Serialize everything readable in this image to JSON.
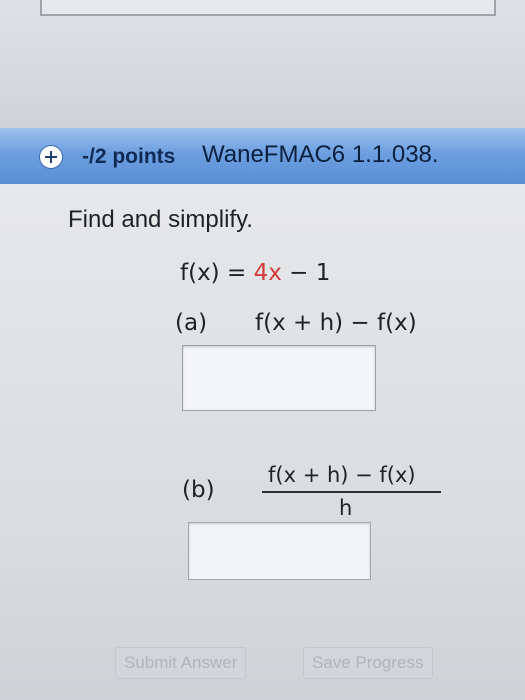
{
  "header": {
    "points_label": "-/2 points",
    "assignment_id": "WaneFMAC6 1.1.038."
  },
  "question": {
    "prompt": "Find and simplify.",
    "function": {
      "lhs": "f(x) = ",
      "rhs": "4x",
      "tail": " − 1"
    },
    "part_a": {
      "label": "(a)",
      "expression": "f(x + h) − f(x)",
      "answer_value": ""
    },
    "part_b": {
      "label": "(b)",
      "numerator": "f(x + h) − f(x)",
      "denominator": "h",
      "answer_value": ""
    }
  },
  "buttons": {
    "submit_label": "Submit Answer",
    "save_label": "Save Progress"
  }
}
